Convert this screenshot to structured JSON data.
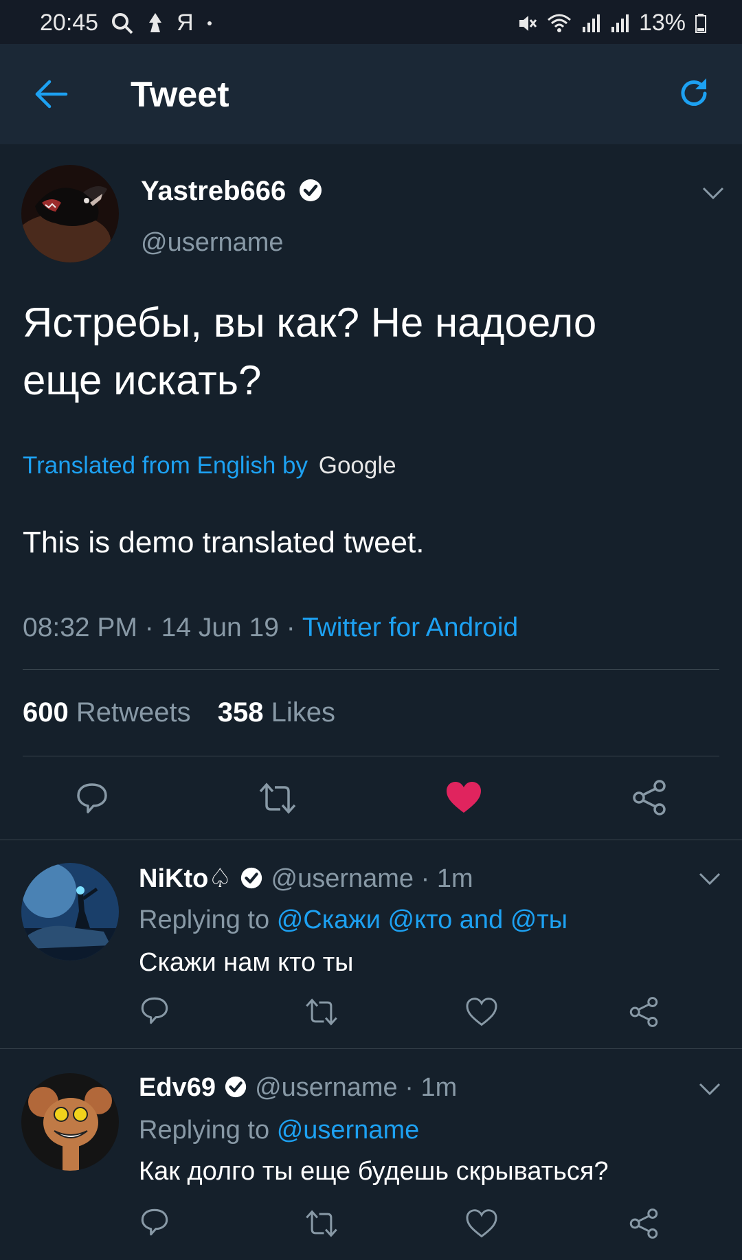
{
  "status_bar": {
    "time": "20:45",
    "icons_left": [
      "search-icon",
      "vpn-icon",
      "yandex-icon",
      "dot-icon"
    ],
    "icons_right": [
      "mute-icon",
      "wifi-icon",
      "signal-icon",
      "signal-icon",
      "battery-icon"
    ],
    "battery": "13%",
    "yandex_glyph": "Я"
  },
  "header": {
    "title": "Tweet",
    "back_icon": "arrow-left-icon",
    "refresh_icon": "refresh-icon",
    "accent": "#1da1f2"
  },
  "main_tweet": {
    "display_name": "Yastreb666",
    "handle": "@username",
    "text_line1": "Ястребы, вы как? Не надоело",
    "text_line2": "еще искать?",
    "translated_label": "Translated from English by",
    "translator": "Google",
    "translation": "This is demo translated tweet.",
    "time": "08:32 PM",
    "date": "14 Jun 19",
    "source": "Twitter for Android",
    "separator": "·",
    "retweets_count": "600",
    "retweets_label": "Retweets",
    "likes_count": "358",
    "likes_label": "Likes",
    "liked": true,
    "like_color": "#e0245e"
  },
  "replies": [
    {
      "display_name": "NiKto♤",
      "handle": "@username",
      "time": "1m",
      "replying_label": "Replying to",
      "mentions": "@Скажи @кто and @ты",
      "text": "Скажи нам кто ты"
    },
    {
      "display_name": "Edv69",
      "handle": "@username",
      "time": "1m",
      "replying_label": "Replying to",
      "mentions": "@username",
      "text": "Как долго ты еще будешь скрываться?"
    }
  ],
  "colors": {
    "background": "#15202b",
    "appbar": "#1b2836",
    "muted": "#8899a6",
    "link": "#1da1f2",
    "divider": "#38444d"
  }
}
